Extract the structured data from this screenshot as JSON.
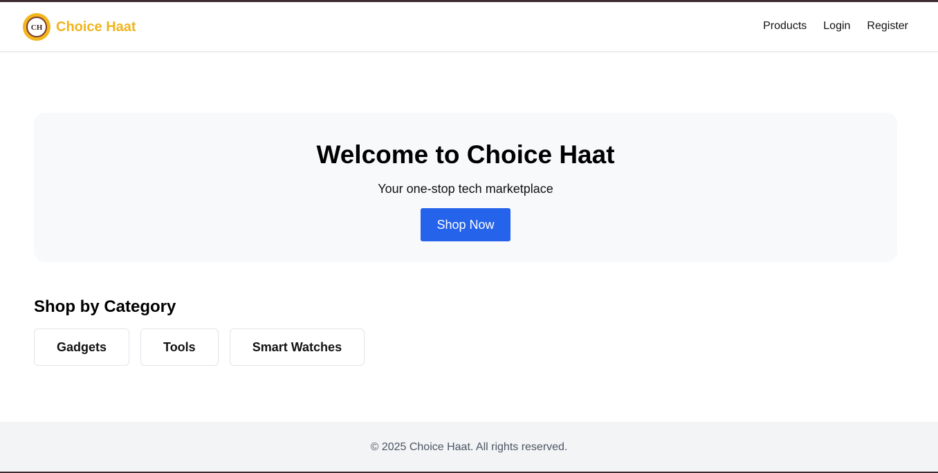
{
  "navbar": {
    "brand_name": "Choice Haat",
    "logo_text": "CH",
    "links": [
      {
        "label": "Products"
      },
      {
        "label": "Login"
      },
      {
        "label": "Register"
      }
    ]
  },
  "hero": {
    "title": "Welcome to Choice Haat",
    "subtitle": "Your one-stop tech marketplace",
    "cta_label": "Shop Now"
  },
  "categories": {
    "title": "Shop by Category",
    "items": [
      {
        "label": "Gadgets"
      },
      {
        "label": "Tools"
      },
      {
        "label": "Smart Watches"
      }
    ]
  },
  "footer": {
    "text": "© 2025 Choice Haat. All rights reserved."
  },
  "colors": {
    "brand": "#f0b41c",
    "primary_button": "#2563eb",
    "hero_bg": "#f8f9fb",
    "footer_bg": "#f3f4f6"
  }
}
